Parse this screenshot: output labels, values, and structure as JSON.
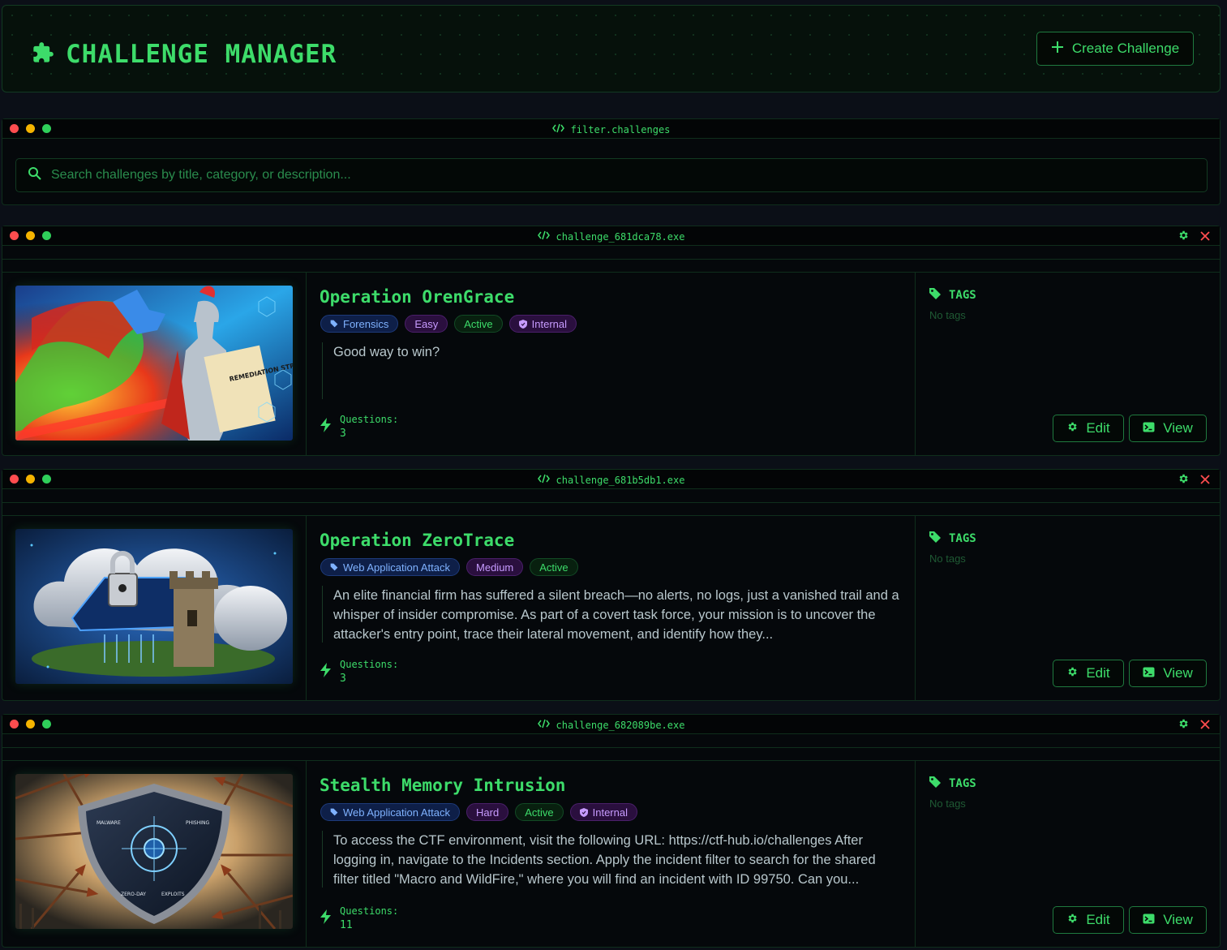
{
  "header": {
    "title": "CHALLENGE MANAGER",
    "create_label": "Create Challenge"
  },
  "filter": {
    "window_title": "filter.challenges",
    "search_placeholder": "Search challenges by title, category, or description..."
  },
  "common": {
    "tags_label": "TAGS",
    "no_tags": "No tags",
    "questions_label": "Questions:",
    "edit_label": "Edit",
    "view_label": "View"
  },
  "challenges": [
    {
      "window_title": "challenge_681dca78.exe",
      "title": "Operation OrenGrace",
      "category": "Forensics",
      "difficulty": "Easy",
      "status": "Active",
      "visibility": "Internal",
      "description": "Good way to win?",
      "questions": "3",
      "thumb_caption": "REMEDIATION STRATEGY"
    },
    {
      "window_title": "challenge_681b5db1.exe",
      "title": "Operation ZeroTrace",
      "category": "Web Application Attack",
      "difficulty": "Medium",
      "status": "Active",
      "visibility": "",
      "description": "An elite financial firm has suffered a silent breach—no alerts, no logs, just a vanished trail and a whisper of insider compromise. As part of a covert task force, your mission is to uncover the attacker's entry point, trace their lateral movement, and identify how they...",
      "questions": "3"
    },
    {
      "window_title": "challenge_682089be.exe",
      "title": "Stealth Memory Intrusion",
      "category": "Web Application Attack",
      "difficulty": "Hard",
      "status": "Active",
      "visibility": "Internal",
      "description": "To access the CTF environment, visit the following URL: https://ctf-hub.io/challenges After logging in, navigate to the Incidents section. Apply the incident filter to search for the shared filter titled \"Macro and WildFire,\" where you will find an incident with ID 99750. Can you...",
      "questions": "11",
      "thumb_labels": [
        "MALWARE",
        "PHISHING",
        "ZERO-DAY",
        "EXPLOITS"
      ]
    }
  ],
  "colors": {
    "accent": "#3ddc6a",
    "background": "#0b0f17",
    "close": "#ff4d4f"
  }
}
